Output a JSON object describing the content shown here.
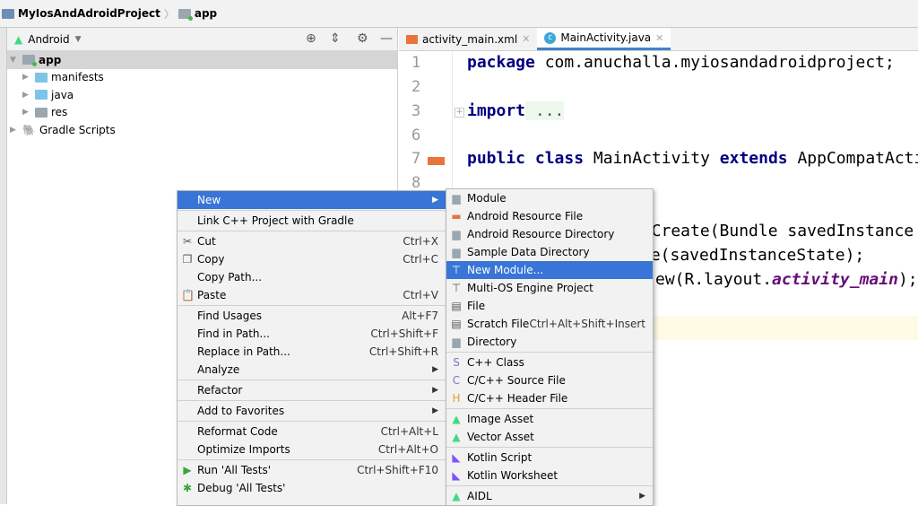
{
  "breadcrumb": {
    "project": "MyIosAndAdroidProject",
    "module": "app"
  },
  "project_panel": {
    "view_selector": "Android",
    "tree": [
      {
        "label": "app",
        "level": 0,
        "expanded": true,
        "icon": "module-folder-icon"
      },
      {
        "label": "manifests",
        "level": 1,
        "icon": "folder-icon"
      },
      {
        "label": "java",
        "level": 1,
        "icon": "folder-icon"
      },
      {
        "label": "res",
        "level": 1,
        "icon": "resource-folder-icon"
      },
      {
        "label": "Gradle Scripts",
        "level": 0,
        "icon": "gradle-icon"
      }
    ]
  },
  "editor": {
    "tabs": [
      {
        "label": "activity_main.xml",
        "active": false
      },
      {
        "label": "MainActivity.java",
        "active": true
      }
    ],
    "line_numbers": [
      "1",
      "2",
      "3",
      "6",
      "7",
      "8"
    ],
    "code": {
      "l1_kw": "package",
      "l1_rest": " com.anuchalla.myiosandadroidproject;",
      "l3_kw": "import",
      "l3_rest": " ...",
      "l7_kw1": "public class",
      "l7_mid": " MainActivity ",
      "l7_kw2": "extends",
      "l7_rest": " AppCompatActiv",
      "frag1": "onCreate(Bundle savedInstance",
      "frag2": "te(savedInstanceState);",
      "frag3a": "ew(R.layout.",
      "frag3b": "activity_main",
      "frag3c": ");"
    }
  },
  "context_menu": {
    "groups": [
      [
        {
          "label": "New",
          "submenu": true,
          "selected": true
        }
      ],
      [
        {
          "label": "Link C++ Project with Gradle"
        }
      ],
      [
        {
          "label": "Cut",
          "shortcut": "Ctrl+X",
          "icon": "scissors-icon"
        },
        {
          "label": "Copy",
          "shortcut": "Ctrl+C",
          "icon": "copy-icon"
        },
        {
          "label": "Copy Path..."
        },
        {
          "label": "Paste",
          "shortcut": "Ctrl+V",
          "icon": "clipboard-icon"
        }
      ],
      [
        {
          "label": "Find Usages",
          "shortcut": "Alt+F7"
        },
        {
          "label": "Find in Path...",
          "shortcut": "Ctrl+Shift+F"
        },
        {
          "label": "Replace in Path...",
          "shortcut": "Ctrl+Shift+R"
        },
        {
          "label": "Analyze",
          "submenu": true
        }
      ],
      [
        {
          "label": "Refactor",
          "submenu": true
        }
      ],
      [
        {
          "label": "Add to Favorites",
          "submenu": true
        }
      ],
      [
        {
          "label": "Reformat Code",
          "shortcut": "Ctrl+Alt+L"
        },
        {
          "label": "Optimize Imports",
          "shortcut": "Ctrl+Alt+O"
        }
      ],
      [
        {
          "label": "Run 'All Tests'",
          "shortcut": "Ctrl+Shift+F10",
          "icon": "run-icon"
        },
        {
          "label": "Debug 'All Tests'",
          "icon": "debug-icon"
        }
      ]
    ]
  },
  "new_submenu": {
    "groups": [
      [
        {
          "label": "Module",
          "icon": "module-icon"
        },
        {
          "label": "Android Resource File",
          "icon": "xml-file-icon"
        },
        {
          "label": "Android Resource Directory",
          "icon": "folder-icon"
        },
        {
          "label": "Sample Data Directory",
          "icon": "folder-icon"
        },
        {
          "label": "New Module...",
          "icon": "new-module-icon",
          "selected": true
        },
        {
          "label": "Multi-OS Engine Project",
          "icon": "new-module-icon"
        },
        {
          "label": "File",
          "icon": "file-icon"
        },
        {
          "label": "Scratch File",
          "shortcut": "Ctrl+Alt+Shift+Insert",
          "icon": "scratch-file-icon"
        },
        {
          "label": "Directory",
          "icon": "folder-icon"
        }
      ],
      [
        {
          "label": "C++ Class",
          "icon": "cpp-class-icon"
        },
        {
          "label": "C/C++ Source File",
          "icon": "cpp-source-icon"
        },
        {
          "label": "C/C++ Header File",
          "icon": "cpp-header-icon"
        }
      ],
      [
        {
          "label": "Image Asset",
          "icon": "android-icon"
        },
        {
          "label": "Vector Asset",
          "icon": "android-icon"
        }
      ],
      [
        {
          "label": "Kotlin Script",
          "icon": "kotlin-icon"
        },
        {
          "label": "Kotlin Worksheet",
          "icon": "kotlin-icon"
        }
      ],
      [
        {
          "label": "AIDL",
          "icon": "android-icon",
          "submenu": true
        }
      ]
    ]
  },
  "colors": {
    "selection": "#3875d7",
    "keyword": "#000080",
    "android_green": "#3ddc84"
  }
}
